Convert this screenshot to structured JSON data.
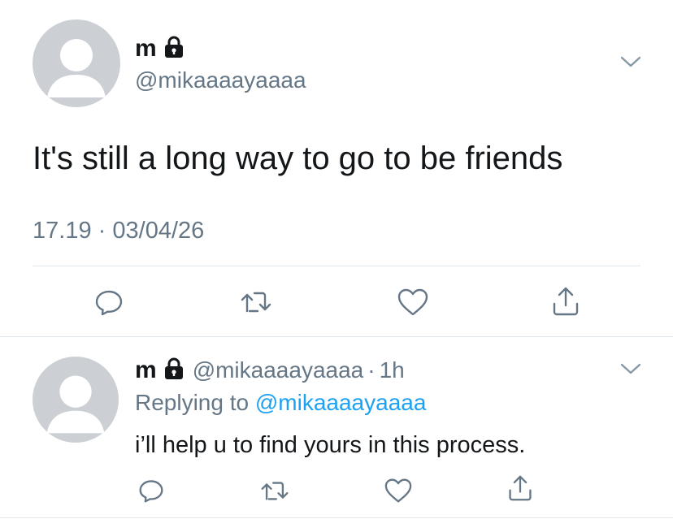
{
  "main_tweet": {
    "display_name": "m",
    "handle": "@mikaaaayaaaa",
    "text": "It's still a long way to go to be friends",
    "time": "17.19",
    "separator": "·",
    "date": "03/04/26",
    "actions": [
      "reply-icon",
      "retweet-icon",
      "like-icon",
      "share-icon"
    ]
  },
  "reply_tweet": {
    "display_name": "m",
    "handle": "@mikaaaayaaaa",
    "separator": "·",
    "age": "1h",
    "replying_prefix": "Replying to",
    "replying_handle": "@mikaaaayaaaa",
    "text": "i’ll help u to find yours in this process.",
    "actions": [
      "reply-icon",
      "retweet-icon",
      "like-icon",
      "share-icon"
    ]
  },
  "colors": {
    "text": "#14171a",
    "secondary": "#657786",
    "link": "#1da1f2",
    "divider": "#e1e8ed",
    "avatar_bg": "#ccd0d4"
  }
}
